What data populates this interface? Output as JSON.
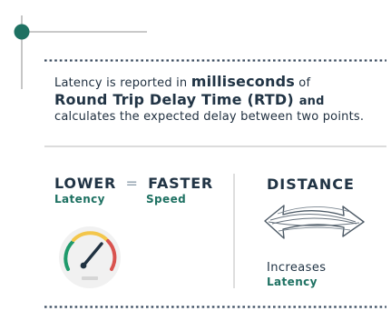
{
  "intro": {
    "line1_prefix": "Latency is reported in",
    "line1_emph": "milliseconds",
    "line1_suffix": "of",
    "line2_main": "Round Trip Delay Time (RTD)",
    "line2_suffix": "and",
    "line3": "calculates the expected delay between two points."
  },
  "comparison": {
    "lower": "LOWER",
    "equals": "=",
    "faster": "FASTER",
    "latency_label": "Latency",
    "speed_label": "Speed"
  },
  "distance": {
    "title": "DISTANCE",
    "effect_line1": "Increases",
    "effect_line2": "Latency"
  },
  "icons": {
    "node": "circle-icon",
    "gauge": "speedometer-icon",
    "arrow": "double-arrow-icon"
  },
  "colors": {
    "accent_teal": "#1e7162",
    "heading_navy": "#213445",
    "rule_gray": "#b6b6b6",
    "dotted_navy": "#3a4b5f",
    "gauge_green": "#1e9a6b",
    "gauge_yellow": "#f3c64b",
    "gauge_red": "#d9534f"
  }
}
